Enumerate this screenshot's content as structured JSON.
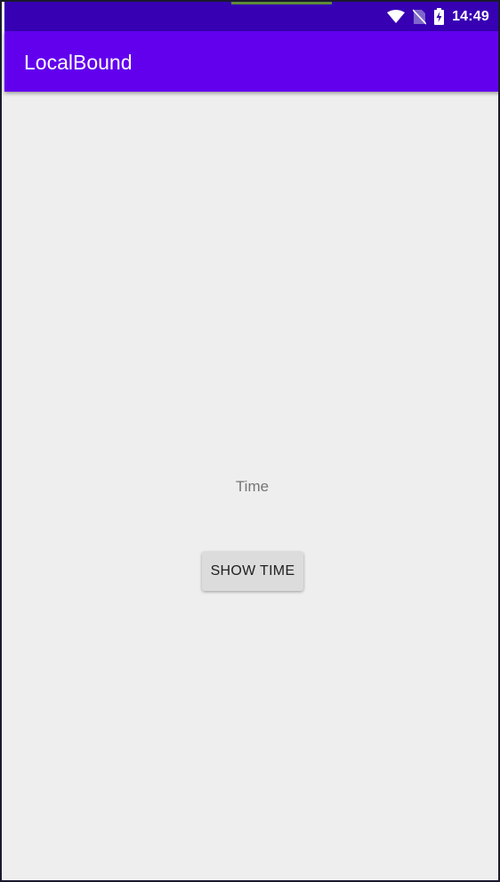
{
  "status_bar": {
    "time": "14:49",
    "icons": [
      "wifi-icon",
      "no-sim-icon",
      "battery-charging-icon"
    ]
  },
  "app_bar": {
    "title": "LocalBound"
  },
  "main": {
    "time_label": "Time",
    "show_time_button": "SHOW TIME"
  },
  "colors": {
    "status_bar": "#3700b3",
    "app_bar": "#6200ee",
    "background": "#eeeeee",
    "button": "#dcdcdc"
  }
}
